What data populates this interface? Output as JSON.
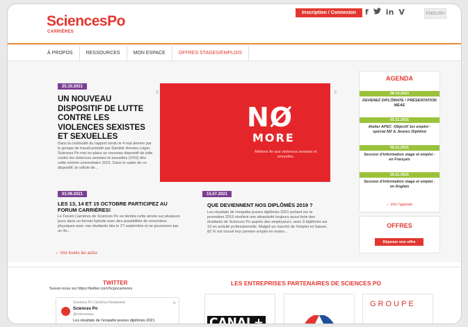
{
  "header": {
    "logo_main": "SciencesPo",
    "logo_sub": "CARRIÈRES",
    "login_label": "Inscription / Connexion",
    "social_icons": [
      "facebook-icon",
      "twitter-icon",
      "linkedin-icon",
      "vimeo-icon"
    ],
    "social_glyphs": [
      "f",
      "🐦",
      "in",
      "V"
    ],
    "lang_label": "ENGLISH"
  },
  "nav": {
    "items": [
      "À PROPOS",
      "RESSOURCES",
      "MON ESPACE",
      "OFFRES STAGES/EMPLOIS"
    ],
    "active_index": 3
  },
  "featured": {
    "date": "25.10.2021",
    "title": "UN NOUVEAU DISPOSITIF DE LUTTE CONTRE LES VIOLENCES SEXISTES ET SEXUELLES",
    "body": "Dans la continuité du rapport rendu le 4 mai dernier par le groupe de travail présidé par Danièle Hervieu-Léger, Sciences Po met en place un nouveau dispositif de lutte contre les violences sexistes et sexuelles (VSS) dès cette rentrée universitaire 2021. Dans le cadre de ce dispositif, la cellule de..."
  },
  "slide": {
    "line1": "NØ",
    "line2": "MORE",
    "caption": "Mettons fin aux violences sexistes et sexuelles."
  },
  "news": [
    {
      "date": "03.09.2021",
      "title": "LES 13, 14 ET 15 OCTOBRE PARTICIPEZ AU FORUM CARRIÈRES!",
      "body": "Le Forum Carrières de Sciences Po se tiendra cette année sur plusieurs jours dans un format hybride avec des possibilités de rencontres physiques avec nos étudiants dès le 27 septembre et se poursuivre par un 4e..."
    },
    {
      "date": "15.07.2021",
      "title": "QUE DEVIENNENT NOS DIPLÔMÉS 2019 ?",
      "body": "Les résultats de l'enquête jeunes diplômés 2021 portant sur la promotion 2019 révèlent une attractivité toujours aussi forte des étudiants de Sciences Po auprès des employeurs, avec 9 diplômés sur 10 en activité professionnelle. Malgré un marché de l'emploi en baisse, 82 % ont trouvé leur premier emploi en moins..."
    }
  ],
  "see_all_news": "Voir toutes les actus",
  "agenda": {
    "title": "AGENDA",
    "events": [
      {
        "date": "28.10.2021",
        "text": "DEVENEZ DIPLÔMATE ! PRÉSENTATION MEAE"
      },
      {
        "date": "03.11.2021",
        "text": "Atelier APEC -Objectif 1er emploi - spécial M2 & Jeunes Diplômé"
      },
      {
        "date": "09.11.2021",
        "text": "Session d'information stage et emploi - en Français"
      },
      {
        "date": "16.11.2021",
        "text": "Session d'information stage et emploi - en Anglais"
      }
    ],
    "link": "Voir l'agenda"
  },
  "offres": {
    "title": "OFFRES",
    "button": "Déposer une offre"
  },
  "twitter": {
    "title": "TWITTER",
    "follow": "Suivez-nous sur https://twitter.com/Scpocarrieres",
    "retweet": "Sciences Po Carrières Retweeted",
    "name": "Sciences Po",
    "handle": "@sciencespo",
    "text": "Les résultats de l'enquête jeunes diplômés 2021"
  },
  "partners": {
    "title": "LES ENTREPRISES PARTENAIRES DE SCIENCES PO",
    "canal": "CANAL+",
    "groupe": "GROUPE"
  },
  "colors": {
    "brand_red": "#e2372f",
    "purple_badge": "#7a3e93",
    "green_badge": "#9bc23b",
    "nav_line": "#e98a3a"
  }
}
